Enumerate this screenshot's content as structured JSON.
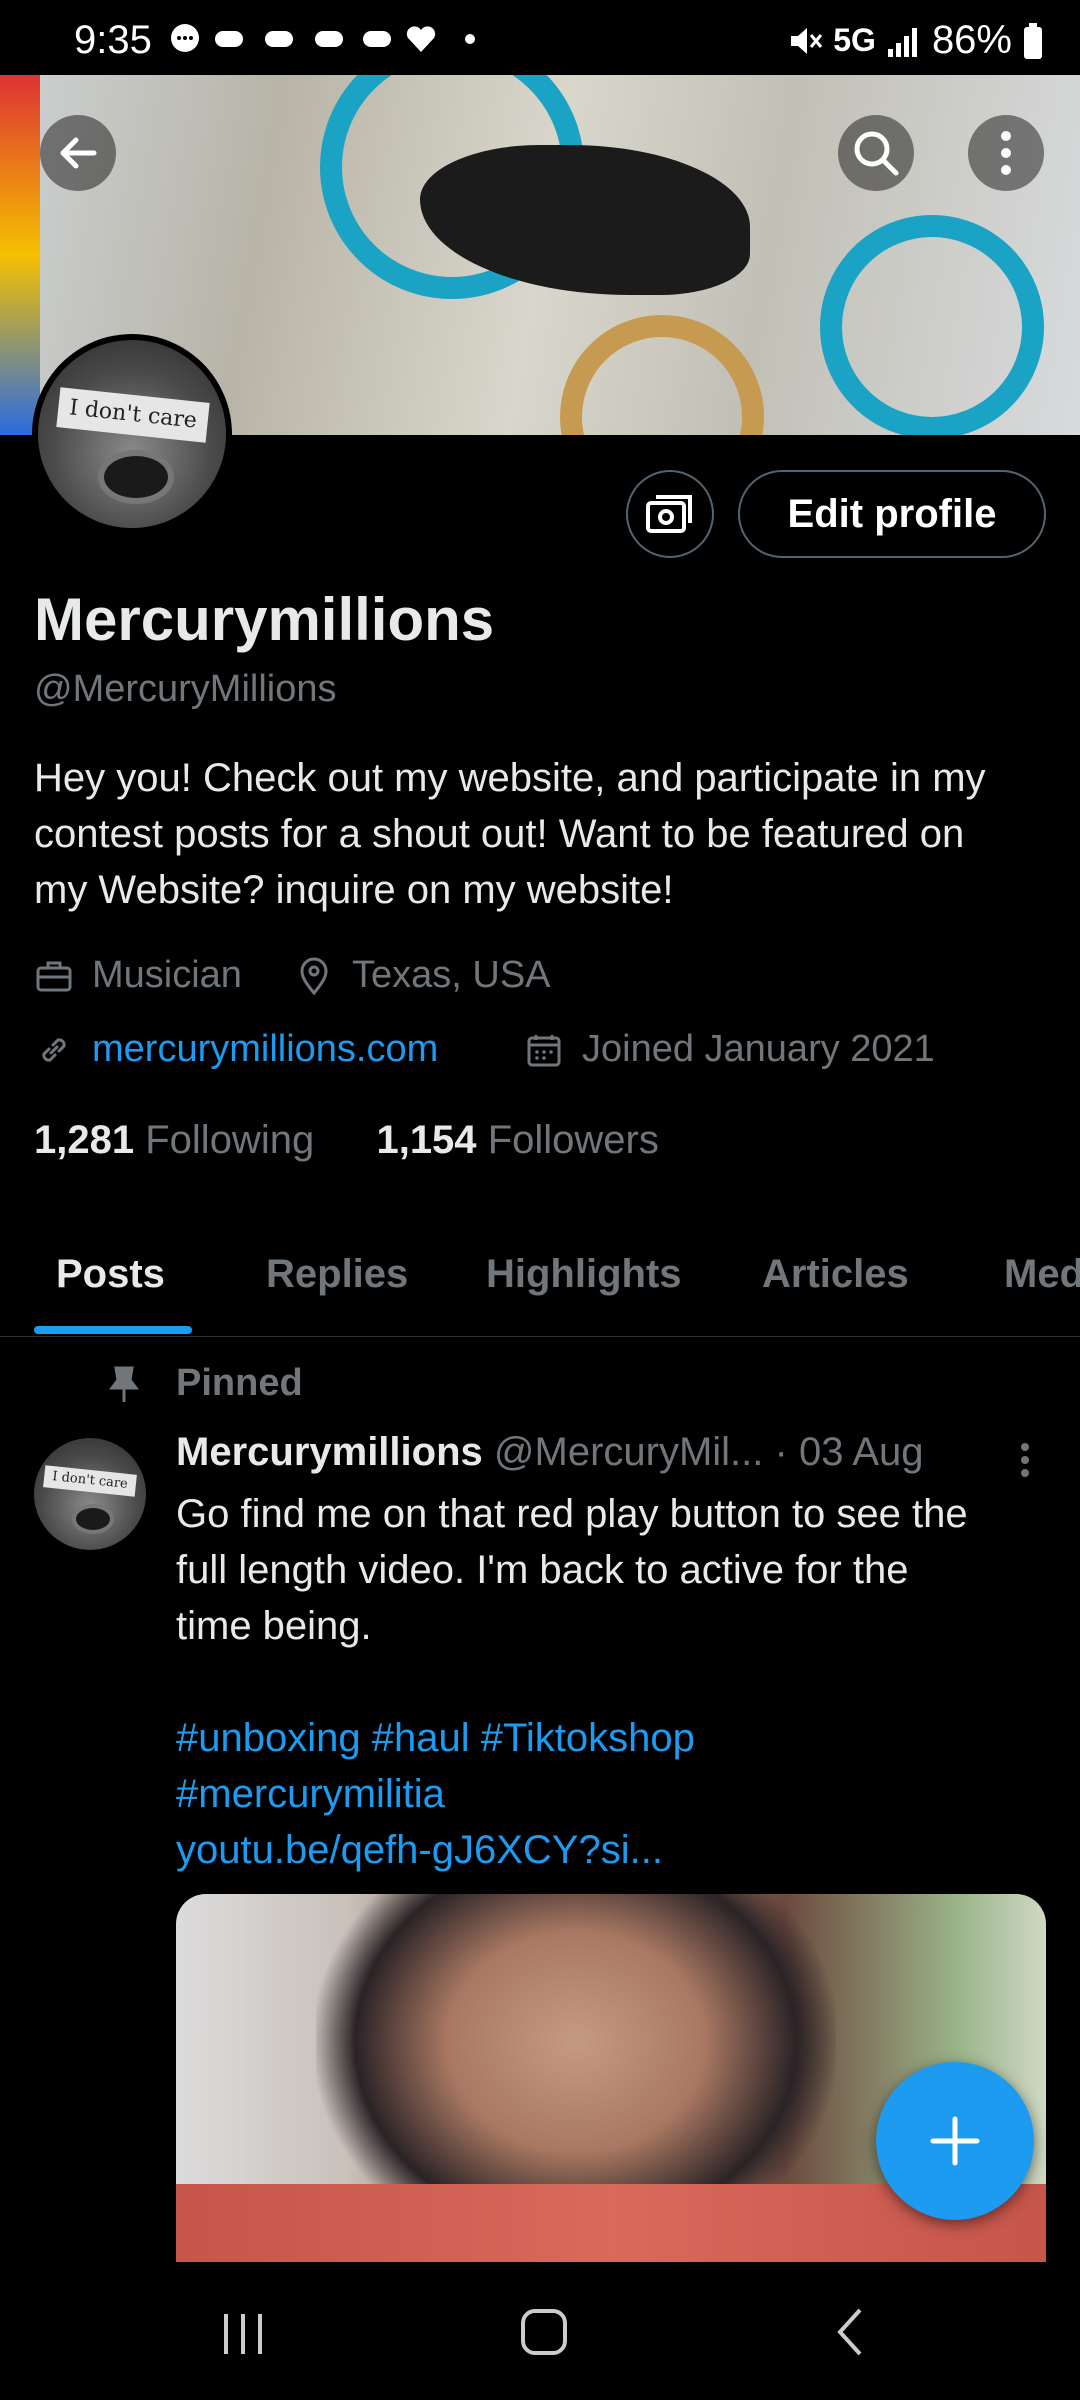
{
  "status_bar": {
    "time": "9:35",
    "network": "5G",
    "battery": "86%"
  },
  "header": {
    "back_icon": "arrow-left-icon",
    "search_icon": "search-icon",
    "more_icon": "more-vertical-icon"
  },
  "profile": {
    "display_name": "Mercurymillions",
    "handle": "@MercuryMillions",
    "avatar_caption": "I don't care",
    "edit_button": "Edit profile",
    "bio": "Hey you! Check out my website, and participate in my contest posts for a shout out! Want to be featured on my Website? inquire on my website!",
    "category": "Musician",
    "location": "Texas, USA",
    "website": "mercurymillions.com",
    "joined": "Joined January 2021",
    "following_count": "1,281",
    "following_label": "Following",
    "followers_count": "1,154",
    "followers_label": "Followers"
  },
  "tabs": [
    {
      "label": "Posts",
      "active": true
    },
    {
      "label": "Replies"
    },
    {
      "label": "Highlights"
    },
    {
      "label": "Articles"
    },
    {
      "label": "Media"
    }
  ],
  "pinned_post": {
    "pinned_label": "Pinned",
    "author": "Mercurymillions",
    "handle": "@MercuryMil...",
    "date": "· 03 Aug",
    "avatar_caption": "I don't care",
    "text_line1": "Go find me on that red play button to see the",
    "text_line2": "full length video. I'm back to active for the",
    "text_line3": "time being.",
    "hashtags_line1": "#unboxing #haul #Tiktokshop",
    "hashtags_line2": "#mercurymilitia",
    "link": "youtu.be/qefh-gJ6XCY?si..."
  },
  "colors": {
    "accent": "#1d9bf0",
    "background": "#000000",
    "secondary_text": "#71767b"
  }
}
